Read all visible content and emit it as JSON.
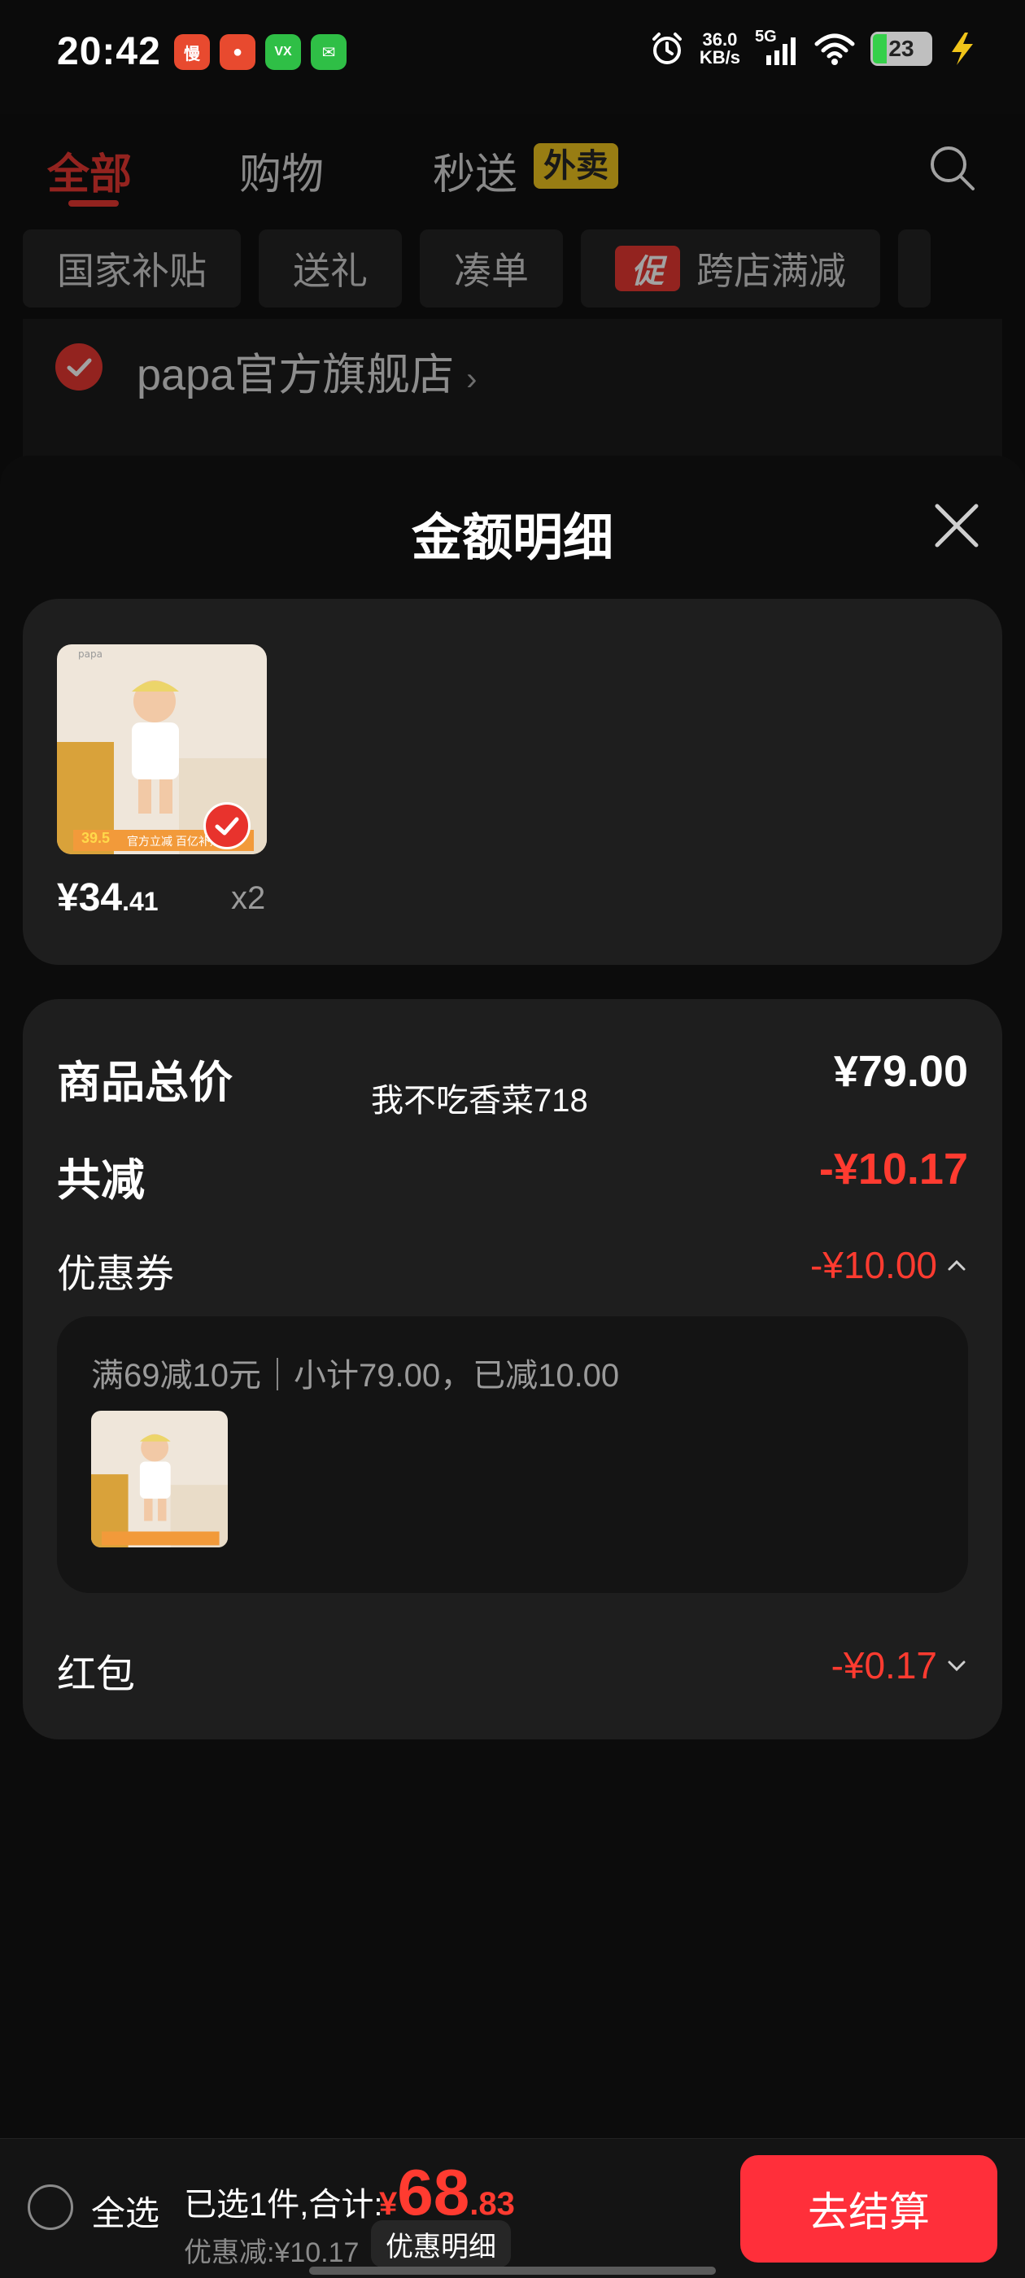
{
  "status_bar": {
    "time": "20:42",
    "app_icons": [
      {
        "name": "app-icon-1",
        "label": "慢",
        "color": "#e84a2f"
      },
      {
        "name": "app-icon-2",
        "label": "●",
        "color": "#e84a2f"
      },
      {
        "name": "app-icon-3",
        "label": "VX",
        "color": "#2fbf46"
      },
      {
        "name": "wechat-icon",
        "label": "✉",
        "color": "#2fbf46"
      }
    ],
    "net_speed_value": "36.0",
    "net_speed_unit": "KB/s",
    "network": "5G",
    "battery": "23"
  },
  "top_tabs": {
    "all": "全部",
    "shopping": "购物",
    "instant": "秒送",
    "takeout_badge": "外卖"
  },
  "chips": [
    "国家补贴",
    "送礼",
    "凑单",
    "跨店满减"
  ],
  "promo_tag": "促",
  "store": {
    "name": "papa官方旗舰店",
    "arrow": "›"
  },
  "sheet": {
    "title": "金额明细"
  },
  "product": {
    "price_int": "¥34",
    "price_dec": ".41",
    "quantity": "x2",
    "thumb_price": "39.5",
    "thumb_tag": "官方立减 百亿补贴"
  },
  "watermark": "我不吃香菜718",
  "summary_rows": {
    "total_label": "商品总价",
    "total_value": "¥79.00",
    "reduce_label": "共减",
    "reduce_value": "-¥10.17",
    "coupon_label": "优惠券",
    "coupon_value": "-¥10.00",
    "redpacket_label": "红包",
    "redpacket_value": "-¥0.17"
  },
  "coupon_detail": {
    "desc": "满69减10元｜小计79.00，已减10.00"
  },
  "bottom_bar": {
    "select_all": "全选",
    "selected_summary": "已选1件,合计:",
    "total_symbol": "¥",
    "total_int": "68",
    "total_dec": ".83",
    "discount": "优惠减:¥10.17",
    "detail_button": "优惠明细",
    "checkout_button": "去结算"
  },
  "colors": {
    "accent_red": "#e8332d",
    "price_red": "#ff3b30",
    "checkout_red": "#ff2f3a",
    "takeout_yellow": "#f0c419"
  }
}
